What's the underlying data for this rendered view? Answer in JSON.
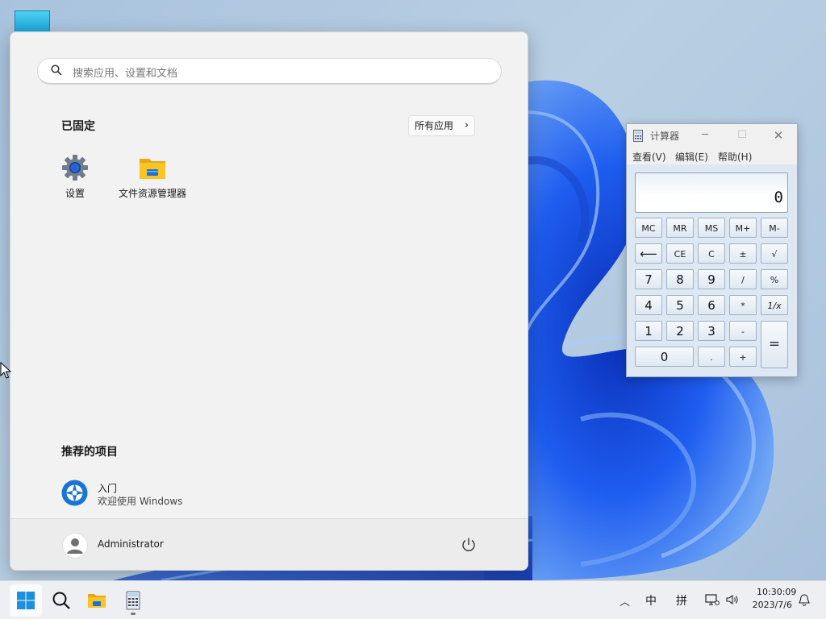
{
  "start_menu": {
    "search_placeholder": "搜索应用、设置和文档",
    "pinned_title": "已固定",
    "all_apps_label": "所有应用",
    "pinned_apps": [
      {
        "label": "设置",
        "icon": "settings-gear-icon"
      },
      {
        "label": "文件资源管理器",
        "icon": "folder-icon"
      }
    ],
    "recommended_title": "推荐的项目",
    "recommended": [
      {
        "title": "入门",
        "subtitle": "欢迎使用 Windows",
        "icon": "get-started-icon"
      }
    ],
    "user_name": "Administrator"
  },
  "calculator": {
    "title": "计算器",
    "menu": [
      "查看(V)",
      "编辑(E)",
      "帮助(H)"
    ],
    "display": "0",
    "keys": {
      "mc": "MC",
      "mr": "MR",
      "ms": "MS",
      "mplus": "M+",
      "mminus": "M-",
      "back": "⟵",
      "ce": "CE",
      "c": "C",
      "plusminus": "±",
      "sqrt": "√",
      "k7": "7",
      "k8": "8",
      "k9": "9",
      "div": "/",
      "pct": "%",
      "k4": "4",
      "k5": "5",
      "k6": "6",
      "mul": "*",
      "recip": "1/x",
      "k1": "1",
      "k2": "2",
      "k3": "3",
      "sub": "-",
      "eq": "=",
      "k0": "0",
      "dot": ".",
      "add": "+"
    }
  },
  "taskbar": {
    "items": [
      "start-icon",
      "search-icon",
      "file-explorer-icon",
      "calculator-icon"
    ],
    "tray": {
      "ime_lang": "中",
      "ime_mode": "拼",
      "time": "10:30:09",
      "date": "2023/7/6"
    }
  },
  "colors": {
    "accent": "#0067c0",
    "wallpaper": "#1f5fe0"
  }
}
